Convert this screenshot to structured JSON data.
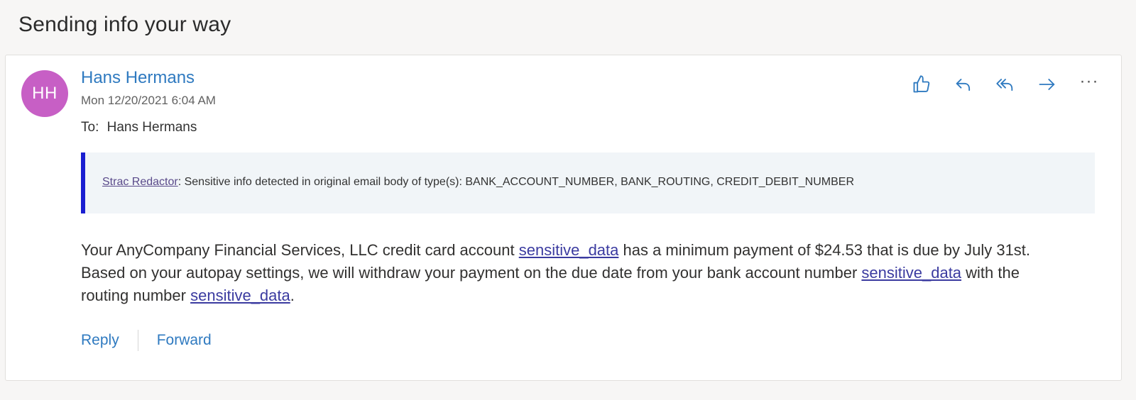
{
  "thread": {
    "subject": "Sending info your way"
  },
  "message": {
    "avatar_initials": "HH",
    "avatar_color": "#c75fc5",
    "sender_name": "Hans Hermans",
    "date": "Mon 12/20/2021 6:04 AM",
    "to_label": "To:",
    "to_name": "Hans Hermans",
    "actions": [
      {
        "name": "like",
        "icon": "thumbs-up-icon"
      },
      {
        "name": "reply",
        "icon": "reply-icon"
      },
      {
        "name": "reply-all",
        "icon": "reply-all-icon"
      },
      {
        "name": "forward",
        "icon": "forward-icon"
      },
      {
        "name": "more",
        "icon": "more-icon",
        "glyph": "···"
      }
    ],
    "banner": {
      "link_text": "Strac Redactor",
      "text": ": Sensitive info detected in original email body of type(s): BANK_ACCOUNT_NUMBER, BANK_ROUTING, CREDIT_DEBIT_NUMBER",
      "accent_color": "#1a1fd1"
    },
    "body": {
      "part1": "Your AnyCompany Financial Services, LLC credit card account ",
      "link1": "sensitive_data",
      "part2": " has a minimum payment of $24.53 that is due by July 31st. Based on your autopay settings, we will withdraw your payment on the due date from your bank account number ",
      "link2": "sensitive_data",
      "part3": " with the routing number ",
      "link3": "sensitive_data",
      "part4": "."
    },
    "footer": {
      "reply_label": "Reply",
      "forward_label": "Forward"
    }
  }
}
